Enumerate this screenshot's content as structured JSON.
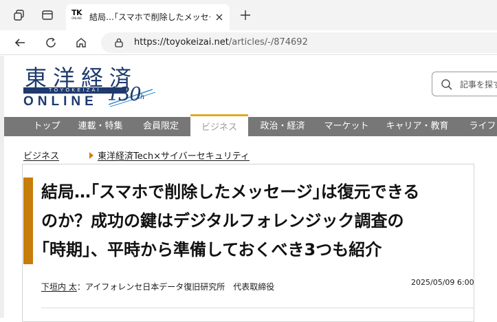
{
  "browser": {
    "tab": {
      "favicon_big": "TK",
      "favicon_small": "ONLINE",
      "title": "結局…｢スマホで削除したメッセージ｣は復元できるのか"
    },
    "address": {
      "domain": "https://toyokeizai.net",
      "path": "/articles/-/874692"
    }
  },
  "site": {
    "logo": {
      "kanji": "東洋経済",
      "band": "TOYOKEIZAI",
      "online": "ONLINE",
      "anniversary": "130",
      "anniversary_suffix": "th"
    },
    "search_placeholder": "記事を探す"
  },
  "nav": {
    "items": [
      {
        "label": "トップ"
      },
      {
        "label": "連載・特集"
      },
      {
        "label": "会員限定"
      },
      {
        "label": "ビジネス"
      },
      {
        "label": "政治・経済"
      },
      {
        "label": "マーケット"
      },
      {
        "label": "キャリア・教育"
      },
      {
        "label": "ライフ"
      }
    ],
    "active_index": 3
  },
  "breadcrumb": [
    {
      "label": "ビジネス"
    },
    {
      "label": "東洋経済Tech×サイバーセキュリティ"
    }
  ],
  "article": {
    "headline_lines": [
      "結局…｢スマホで削除したメッセージ｣は復元できる",
      "のか？成功の鍵はデジタルフォレンジック調査の",
      "｢時期｣、平時から準備しておくべき3つも紹介"
    ],
    "author": "下垣内 太",
    "affiliation": "：アイフォレンセ日本データ復旧研究所　代表取締役",
    "date": "2025/05/09 6:00"
  },
  "colors": {
    "logo_navy": "#1e3a6e",
    "nav_bg": "#777777",
    "nav_active_accent": "#e0aa25",
    "title_accent": "#c77d0a"
  }
}
